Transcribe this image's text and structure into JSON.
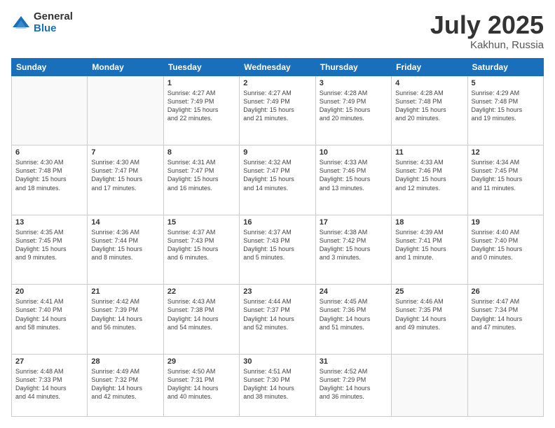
{
  "logo": {
    "general": "General",
    "blue": "Blue"
  },
  "header": {
    "month": "July 2025",
    "location": "Kakhun, Russia"
  },
  "weekdays": [
    "Sunday",
    "Monday",
    "Tuesday",
    "Wednesday",
    "Thursday",
    "Friday",
    "Saturday"
  ],
  "weeks": [
    [
      {
        "day": "",
        "detail": ""
      },
      {
        "day": "",
        "detail": ""
      },
      {
        "day": "1",
        "detail": "Sunrise: 4:27 AM\nSunset: 7:49 PM\nDaylight: 15 hours\nand 22 minutes."
      },
      {
        "day": "2",
        "detail": "Sunrise: 4:27 AM\nSunset: 7:49 PM\nDaylight: 15 hours\nand 21 minutes."
      },
      {
        "day": "3",
        "detail": "Sunrise: 4:28 AM\nSunset: 7:49 PM\nDaylight: 15 hours\nand 20 minutes."
      },
      {
        "day": "4",
        "detail": "Sunrise: 4:28 AM\nSunset: 7:48 PM\nDaylight: 15 hours\nand 20 minutes."
      },
      {
        "day": "5",
        "detail": "Sunrise: 4:29 AM\nSunset: 7:48 PM\nDaylight: 15 hours\nand 19 minutes."
      }
    ],
    [
      {
        "day": "6",
        "detail": "Sunrise: 4:30 AM\nSunset: 7:48 PM\nDaylight: 15 hours\nand 18 minutes."
      },
      {
        "day": "7",
        "detail": "Sunrise: 4:30 AM\nSunset: 7:47 PM\nDaylight: 15 hours\nand 17 minutes."
      },
      {
        "day": "8",
        "detail": "Sunrise: 4:31 AM\nSunset: 7:47 PM\nDaylight: 15 hours\nand 16 minutes."
      },
      {
        "day": "9",
        "detail": "Sunrise: 4:32 AM\nSunset: 7:47 PM\nDaylight: 15 hours\nand 14 minutes."
      },
      {
        "day": "10",
        "detail": "Sunrise: 4:33 AM\nSunset: 7:46 PM\nDaylight: 15 hours\nand 13 minutes."
      },
      {
        "day": "11",
        "detail": "Sunrise: 4:33 AM\nSunset: 7:46 PM\nDaylight: 15 hours\nand 12 minutes."
      },
      {
        "day": "12",
        "detail": "Sunrise: 4:34 AM\nSunset: 7:45 PM\nDaylight: 15 hours\nand 11 minutes."
      }
    ],
    [
      {
        "day": "13",
        "detail": "Sunrise: 4:35 AM\nSunset: 7:45 PM\nDaylight: 15 hours\nand 9 minutes."
      },
      {
        "day": "14",
        "detail": "Sunrise: 4:36 AM\nSunset: 7:44 PM\nDaylight: 15 hours\nand 8 minutes."
      },
      {
        "day": "15",
        "detail": "Sunrise: 4:37 AM\nSunset: 7:43 PM\nDaylight: 15 hours\nand 6 minutes."
      },
      {
        "day": "16",
        "detail": "Sunrise: 4:37 AM\nSunset: 7:43 PM\nDaylight: 15 hours\nand 5 minutes."
      },
      {
        "day": "17",
        "detail": "Sunrise: 4:38 AM\nSunset: 7:42 PM\nDaylight: 15 hours\nand 3 minutes."
      },
      {
        "day": "18",
        "detail": "Sunrise: 4:39 AM\nSunset: 7:41 PM\nDaylight: 15 hours\nand 1 minute."
      },
      {
        "day": "19",
        "detail": "Sunrise: 4:40 AM\nSunset: 7:40 PM\nDaylight: 15 hours\nand 0 minutes."
      }
    ],
    [
      {
        "day": "20",
        "detail": "Sunrise: 4:41 AM\nSunset: 7:40 PM\nDaylight: 14 hours\nand 58 minutes."
      },
      {
        "day": "21",
        "detail": "Sunrise: 4:42 AM\nSunset: 7:39 PM\nDaylight: 14 hours\nand 56 minutes."
      },
      {
        "day": "22",
        "detail": "Sunrise: 4:43 AM\nSunset: 7:38 PM\nDaylight: 14 hours\nand 54 minutes."
      },
      {
        "day": "23",
        "detail": "Sunrise: 4:44 AM\nSunset: 7:37 PM\nDaylight: 14 hours\nand 52 minutes."
      },
      {
        "day": "24",
        "detail": "Sunrise: 4:45 AM\nSunset: 7:36 PM\nDaylight: 14 hours\nand 51 minutes."
      },
      {
        "day": "25",
        "detail": "Sunrise: 4:46 AM\nSunset: 7:35 PM\nDaylight: 14 hours\nand 49 minutes."
      },
      {
        "day": "26",
        "detail": "Sunrise: 4:47 AM\nSunset: 7:34 PM\nDaylight: 14 hours\nand 47 minutes."
      }
    ],
    [
      {
        "day": "27",
        "detail": "Sunrise: 4:48 AM\nSunset: 7:33 PM\nDaylight: 14 hours\nand 44 minutes."
      },
      {
        "day": "28",
        "detail": "Sunrise: 4:49 AM\nSunset: 7:32 PM\nDaylight: 14 hours\nand 42 minutes."
      },
      {
        "day": "29",
        "detail": "Sunrise: 4:50 AM\nSunset: 7:31 PM\nDaylight: 14 hours\nand 40 minutes."
      },
      {
        "day": "30",
        "detail": "Sunrise: 4:51 AM\nSunset: 7:30 PM\nDaylight: 14 hours\nand 38 minutes."
      },
      {
        "day": "31",
        "detail": "Sunrise: 4:52 AM\nSunset: 7:29 PM\nDaylight: 14 hours\nand 36 minutes."
      },
      {
        "day": "",
        "detail": ""
      },
      {
        "day": "",
        "detail": ""
      }
    ]
  ]
}
